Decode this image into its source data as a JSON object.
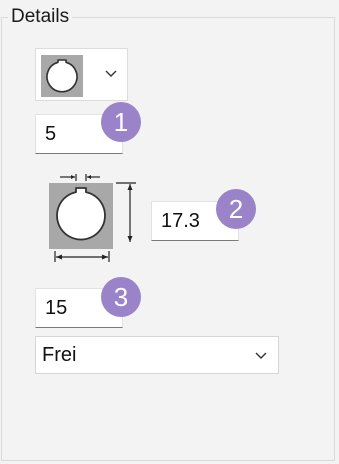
{
  "group": {
    "title": "Details"
  },
  "shape_selector": {
    "icon": "circle-with-keyway-icon"
  },
  "fields": {
    "field_1": "5",
    "field_2": "17.3",
    "field_3": "15"
  },
  "badges": {
    "badge_1": "1",
    "badge_2": "2",
    "badge_3": "3"
  },
  "dropdown": {
    "value": "Frei"
  },
  "colors": {
    "badge": "#9a83c8",
    "shape_fill": "#a8a8a8",
    "background": "#f3f3f3"
  }
}
